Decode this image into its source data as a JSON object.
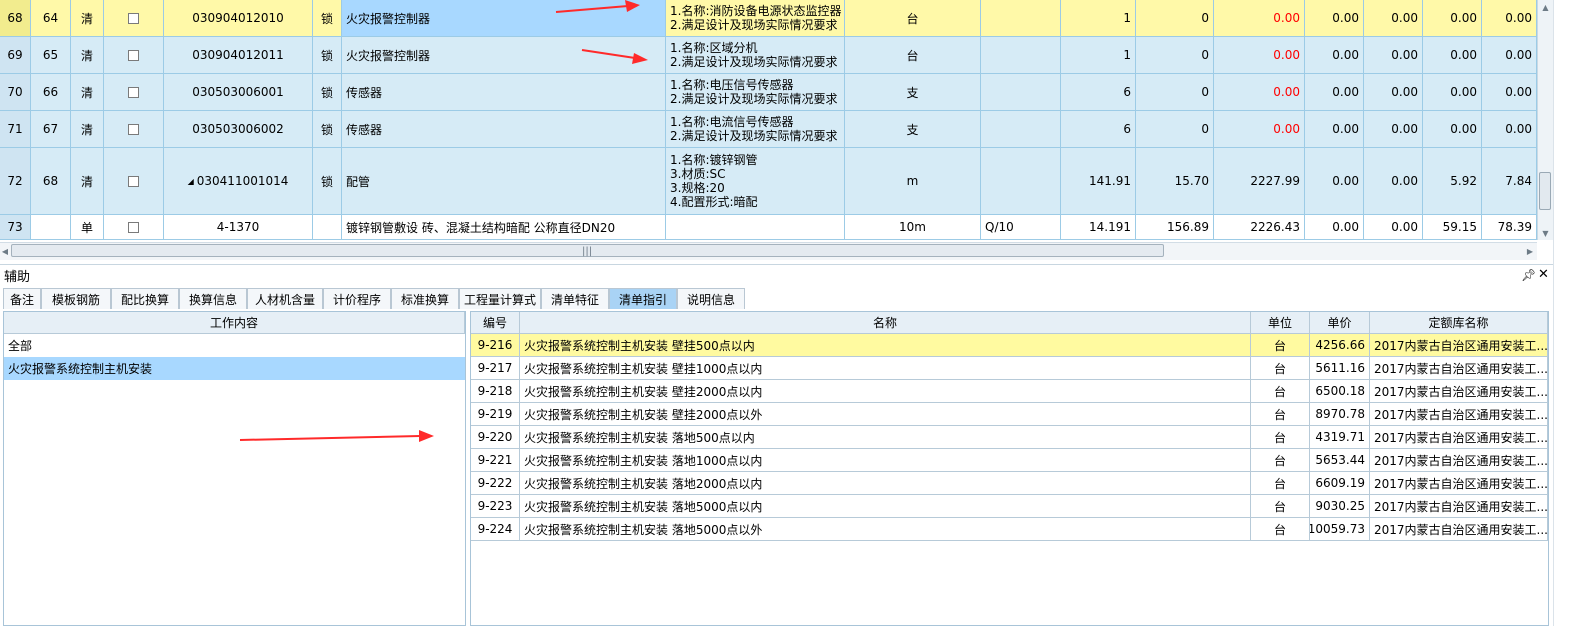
{
  "top_grid": {
    "rows": [
      {
        "rownum": "68",
        "seq": "64",
        "type": "清",
        "code": "030904012010",
        "tri": false,
        "lock": "锁",
        "name": "火灾报警控制器",
        "features": [
          "1.名称:消防设备电源状态监控器",
          "2.满足设计及现场实际情况要求"
        ],
        "unit": "台",
        "factor": "",
        "qty": "1",
        "price": "0",
        "total": "0.00",
        "totalRed": true,
        "v1": "0.00",
        "v2": "0.00",
        "v3": "0.00",
        "v4": "0.00",
        "style": "selected"
      },
      {
        "rownum": "69",
        "seq": "65",
        "type": "清",
        "code": "030904012011",
        "tri": false,
        "lock": "锁",
        "name": "火灾报警控制器",
        "features": [
          "1.名称:区域分机",
          "2.满足设计及现场实际情况要求"
        ],
        "unit": "台",
        "factor": "",
        "qty": "1",
        "price": "0",
        "total": "0.00",
        "totalRed": true,
        "v1": "0.00",
        "v2": "0.00",
        "v3": "0.00",
        "v4": "0.00",
        "style": "normal"
      },
      {
        "rownum": "70",
        "seq": "66",
        "type": "清",
        "code": "030503006001",
        "tri": false,
        "lock": "锁",
        "name": "传感器",
        "features": [
          "1.名称:电压信号传感器",
          "2.满足设计及现场实际情况要求"
        ],
        "unit": "支",
        "factor": "",
        "qty": "6",
        "price": "0",
        "total": "0.00",
        "totalRed": true,
        "v1": "0.00",
        "v2": "0.00",
        "v3": "0.00",
        "v4": "0.00",
        "style": "normal"
      },
      {
        "rownum": "71",
        "seq": "67",
        "type": "清",
        "code": "030503006002",
        "tri": false,
        "lock": "锁",
        "name": "传感器",
        "features": [
          "1.名称:电流信号传感器",
          "2.满足设计及现场实际情况要求"
        ],
        "unit": "支",
        "factor": "",
        "qty": "6",
        "price": "0",
        "total": "0.00",
        "totalRed": true,
        "v1": "0.00",
        "v2": "0.00",
        "v3": "0.00",
        "v4": "0.00",
        "style": "normal"
      },
      {
        "rownum": "72",
        "seq": "68",
        "type": "清",
        "code": "030411001014",
        "tri": true,
        "lock": "锁",
        "name": "配管",
        "features": [
          "1.名称:镀锌钢管",
          "3.材质:SC",
          "3.规格:20",
          "4.配置形式:暗配"
        ],
        "unit": "m",
        "factor": "",
        "qty": "141.91",
        "price": "15.70",
        "total": "2227.99",
        "totalRed": false,
        "v1": "0.00",
        "v2": "0.00",
        "v3": "5.92",
        "v4": "7.84",
        "style": "normal"
      },
      {
        "rownum": "73",
        "seq": "",
        "type": "单",
        "code": "4-1370",
        "tri": false,
        "lock": "",
        "name": "镀锌钢管敷设 砖、混凝土结构暗配 公称直径DN20",
        "features": [],
        "unit": "10m",
        "factor": "Q/10",
        "qty": "14.191",
        "price": "156.89",
        "total": "2226.43",
        "totalRed": false,
        "v1": "0.00",
        "v2": "0.00",
        "v3": "59.15",
        "v4": "78.39",
        "style": "unit"
      }
    ],
    "scroll_grip": "|||"
  },
  "aux": {
    "title": "辅助",
    "pin": "ᅵ",
    "close": "✕",
    "tabs": [
      "备注",
      "模板钢筋",
      "配比换算",
      "换算信息",
      "人材机含量",
      "计价程序",
      "标准换算",
      "工程量计算式",
      "清单特征",
      "清单指引",
      "说明信息"
    ],
    "active_tab": 9
  },
  "left_pane": {
    "header": "工作内容",
    "items": [
      "全部",
      "火灾报警系统控制主机安装"
    ],
    "selected": 1
  },
  "right_pane": {
    "headers": [
      "编号",
      "名称",
      "单位",
      "单价",
      "定额库名称"
    ],
    "rows": [
      {
        "code": "9-216",
        "name": "火灾报警系统控制主机安装 壁挂500点以内",
        "unit": "台",
        "price": "4256.66",
        "lib": "2017内蒙古自治区通用安装工..."
      },
      {
        "code": "9-217",
        "name": "火灾报警系统控制主机安装 壁挂1000点以内",
        "unit": "台",
        "price": "5611.16",
        "lib": "2017内蒙古自治区通用安装工..."
      },
      {
        "code": "9-218",
        "name": "火灾报警系统控制主机安装 壁挂2000点以内",
        "unit": "台",
        "price": "6500.18",
        "lib": "2017内蒙古自治区通用安装工..."
      },
      {
        "code": "9-219",
        "name": "火灾报警系统控制主机安装 壁挂2000点以外",
        "unit": "台",
        "price": "8970.78",
        "lib": "2017内蒙古自治区通用安装工..."
      },
      {
        "code": "9-220",
        "name": "火灾报警系统控制主机安装 落地500点以内",
        "unit": "台",
        "price": "4319.71",
        "lib": "2017内蒙古自治区通用安装工..."
      },
      {
        "code": "9-221",
        "name": "火灾报警系统控制主机安装 落地1000点以内",
        "unit": "台",
        "price": "5653.44",
        "lib": "2017内蒙古自治区通用安装工..."
      },
      {
        "code": "9-222",
        "name": "火灾报警系统控制主机安装 落地2000点以内",
        "unit": "台",
        "price": "6609.19",
        "lib": "2017内蒙古自治区通用安装工..."
      },
      {
        "code": "9-223",
        "name": "火灾报警系统控制主机安装 落地5000点以内",
        "unit": "台",
        "price": "9030.25",
        "lib": "2017内蒙古自治区通用安装工..."
      },
      {
        "code": "9-224",
        "name": "火灾报警系统控制主机安装 落地5000点以外",
        "unit": "台",
        "price": "10059.73",
        "lib": "2017内蒙古自治区通用安装工..."
      }
    ],
    "selected": 0
  },
  "colors": {
    "annotation_arrow": "#ff2a2a",
    "selection_yellow": "#fff9a8",
    "selection_blue": "#a8d8ff",
    "row_blue": "#d6ebf6"
  }
}
